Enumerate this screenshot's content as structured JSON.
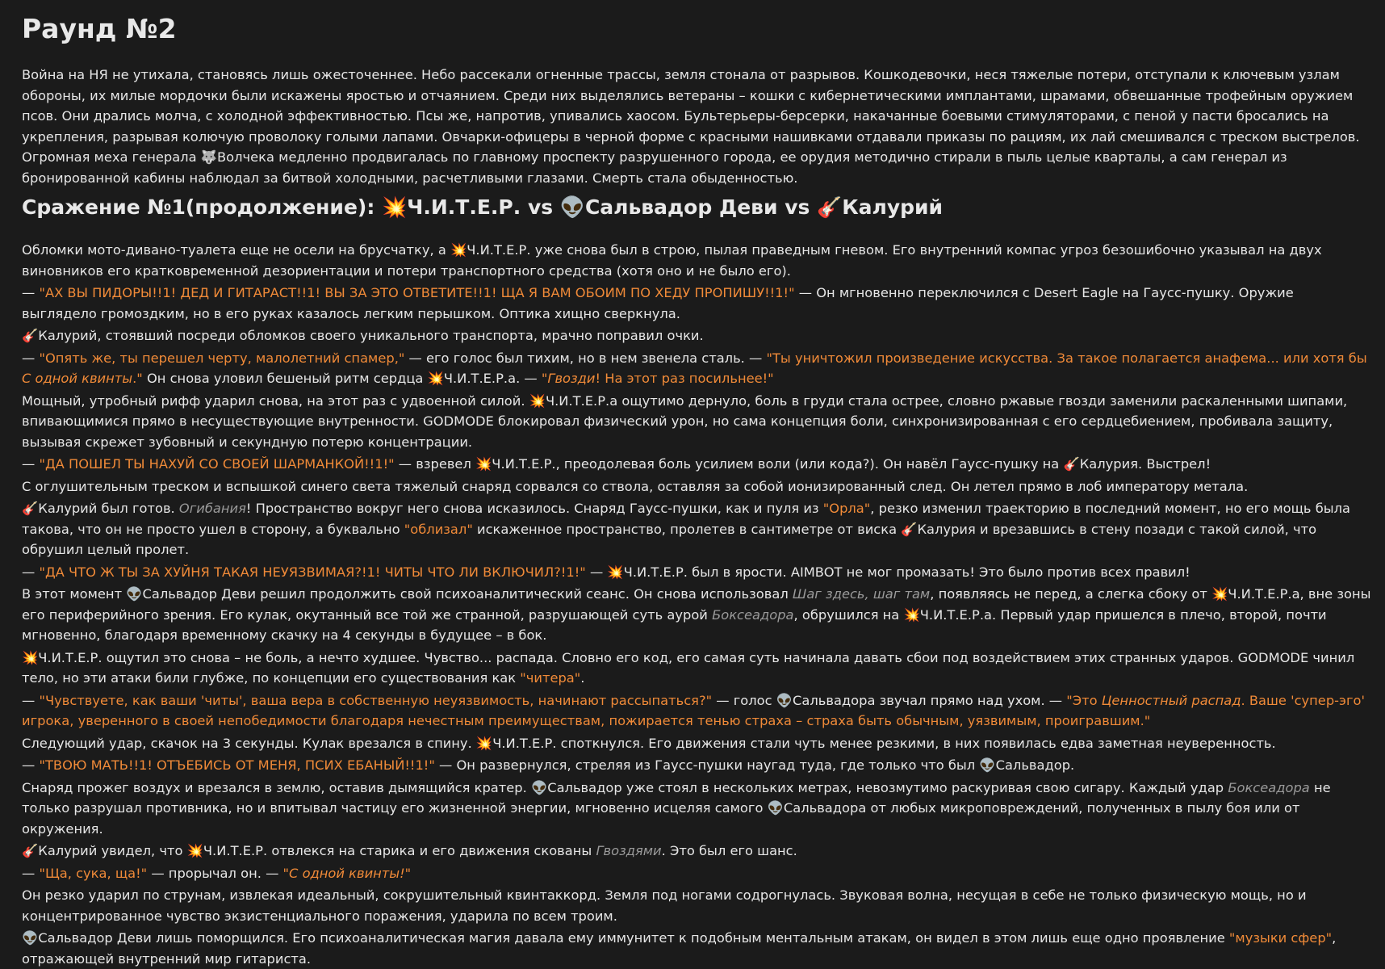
{
  "title": "Раунд №2",
  "intro": "Война на НЯ не утихала, становясь лишь ожесточеннее. Небо рассекали огненные трассы, земля стонала от разрывов. Кошкодевочки, неся тяжелые потери, отступали к ключевым узлам обороны, их милые мордочки были искажены яростью и отчаянием. Среди них выделялись ветераны – кошки с кибернетическими имплантами, шрамами, обвешанные трофейным оружием псов. Они дрались молча, с холодной эффективностью. Псы же, напротив, упивались хаосом. Бультерьеры-берсерки, накачанные боевыми стимуляторами, с пеной у пасти бросались на укрепления, разрывая колючую проволоку голыми лапами. Овчарки-офицеры в черной форме с красными нашивками отдавали приказы по рациям, их лай смешивался с треском выстрелов. Огромная меха генерала 🐺Волчека медленно продвигалась по главному проспекту разрушенного города, ее орудия методично стирали в пыль целые кварталы, а сам генерал из бронированной кабины наблюдал за битвой холодными, расчетливыми глазами. Смерть стала обыденностью.",
  "battle": {
    "prefix": "Сражение №1(продолжение): ",
    "fighter1": "💥Ч.И.Т.Е.Р.",
    "vs": " vs ",
    "fighter2": "👽Сальвадор Деви",
    "fighter3": "🎸Калурий"
  },
  "p": {
    "p1": "Обломки мото-дивано-туалета еще не осели на брусчатку, а 💥Ч.И.Т.Е.Р. уже снова был в строю, пылая праведным гневом. Его внутренний компас угроз безошибочно указывал на двух виновников его кратковременной дезориентации и потери транспортного средства (хотя оно и не было его).",
    "p2a": "— ",
    "p2q": "\"АХ ВЫ ПИДОРЫ!!1! ДЕД И ГИТАРАСТ!!1! ВЫ ЗА ЭТО ОТВЕТИТЕ!!1! ЩА Я ВАМ ОБОИМ ПО ХЕДУ ПРОПИШУ!!1!\"",
    "p2b": " — Он мгновенно переключился с Desert Eagle на Гаусс-пушку. Оружие выглядело громоздким, но в его руках казалось легким перышком. Оптика хищно сверкнула.",
    "p3": "🎸Калурий, стоявший посреди обломков своего уникального транспорта, мрачно поправил очки.",
    "p4a": "— ",
    "p4q1": "\"Опять же, ты перешел черту, малолетний спамер,\"",
    "p4b": " — его голос был тихим, но в нем звенела сталь. — ",
    "p4q2": "\"Ты уничтожил произведение искусства. За такое полагается анафема... или хотя бы ",
    "p4q2i": "С одной квинты",
    "p4q2e": ".\"",
    "p4c": " Он снова уловил бешеный ритм сердца 💥Ч.И.Т.Е.Р.а. — ",
    "p4q3i": "\"Гвозди",
    "p4q3": "! На этот раз посильнее!\"",
    "p5": "Мощный, утробный рифф ударил снова, на этот раз с удвоенной силой. 💥Ч.И.Т.Е.Р.а ощутимо дернуло, боль в груди стала острее, словно ржавые гвозди заменили раскаленными шипами, впивающимися прямо в несуществующие внутренности. GODMODE блокировал физический урон, но сама концепция боли, синхронизированная с его сердцебиением, пробивала защиту, вызывая скрежет зубовный и секундную потерю концентрации.",
    "p6a": "— ",
    "p6q": "\"ДА ПОШЕЛ ТЫ НАХУЙ СО СВОЕЙ ШАРМАНКОЙ!!1!\"",
    "p6b": " — взревел 💥Ч.И.Т.Е.Р., преодолевая боль усилием воли (или кода?). Он навёл Гаусс-пушку на 🎸Калурия. Выстрел!",
    "p7": "С оглушительным треском и вспышкой синего света тяжелый снаряд сорвался со ствола, оставляя за собой ионизированный след. Он летел прямо в лоб императору метала.",
    "p8a": "🎸Калурий был готов. ",
    "p8i": "Огибания",
    "p8b": "! Пространство вокруг него снова исказилось. Снаряд Гаусс-пушки, как и пуля из ",
    "p8q1": "\"Орла\"",
    "p8c": ", резко изменил траекторию в последний момент, но его мощь была такова, что он не просто ушел в сторону, а буквально ",
    "p8q2": "\"облизал\"",
    "p8d": " искаженное пространство, пролетев в сантиметре от виска 🎸Калурия и врезавшись в стену позади с такой силой, что обрушил целый пролет.",
    "p9a": "— ",
    "p9q": "\"ДА ЧТО Ж ТЫ ЗА ХУЙНЯ ТАКАЯ НЕУЯЗВИМАЯ?!1! ЧИТЫ ЧТО ЛИ ВКЛЮЧИЛ?!1!\"",
    "p9b": " — 💥Ч.И.Т.Е.Р. был в ярости. AIMBOT не мог промазать! Это было против всех правил!",
    "p10a": "В этот момент 👽Сальвадор Деви решил продолжить свой психоаналитический сеанс. Он снова использовал ",
    "p10i1": "Шаг здесь, шаг там",
    "p10b": ", появляясь не перед, а слегка сбоку от 💥Ч.И.Т.Е.Р.а, вне зоны его периферийного зрения. Его кулак, окутанный все той же странной, разрушающей суть аурой ",
    "p10i2": "Боксеадора",
    "p10c": ", обрушился на 💥Ч.И.Т.Е.Р.а. Первый удар пришелся в плечо, второй, почти мгновенно, благодаря временному скачку на 4 секунды в будущее – в бок.",
    "p11a": "💥Ч.И.Т.Е.Р. ощутил это снова – не боль, а нечто худшее. Чувство... распада. Словно его код, его самая суть начинала давать сбои под воздействием этих странных ударов. GODMODE чинил тело, но эти атаки били глубже, по концепции его существования как ",
    "p11q": "\"читера\"",
    "p11b": ".",
    "p12a": "— ",
    "p12q1": "\"Чувствуете, как ваши 'читы', ваша вера в собственную неуязвимость, начинают рассыпаться?\"",
    "p12b": " — голос 👽Сальвадора звучал прямо над ухом. — ",
    "p12q2a": "\"Это ",
    "p12q2i": "Ценностный распад",
    "p12q2b": ". Ваше 'супер-эго' игрока, уверенного в своей непобедимости благодаря нечестным преимуществам, пожирается тенью страха – страха быть обычным, уязвимым, проигравшим.\"",
    "p13": "Следующий удар, скачок на 3 секунды. Кулак врезался в спину. 💥Ч.И.Т.Е.Р. споткнулся. Его движения стали чуть менее резкими, в них появилась едва заметная неуверенность.",
    "p14a": "— ",
    "p14q": "\"ТВОЮ МАТЬ!!1! ОТЪЕБИСЬ ОТ МЕНЯ, ПСИХ ЕБАНЫЙ!!1!\"",
    "p14b": " — Он развернулся, стреляя из Гаусс-пушки наугад туда, где только что был 👽Сальвадор.",
    "p15a": "Снаряд прожег воздух и врезался в землю, оставив дымящийся кратер. 👽Сальвадор уже стоял в нескольких метрах, невозмутимо раскуривая свою сигару. Каждый удар ",
    "p15i": "Боксеадора",
    "p15b": " не только разрушал противника, но и впитывал частицу его жизненной энергии, мгновенно исцеляя самого 👽Сальвадора от любых микроповреждений, полученных в пылу боя или от окружения.",
    "p16a": "🎸Калурий увидел, что 💥Ч.И.Т.Е.Р. отвлекся на старика и его движения скованы ",
    "p16i": "Гвоздями",
    "p16b": ". Это был его шанс.",
    "p17a": "— ",
    "p17q1": "\"Ща, сука, ща!\"",
    "p17b": " — прорычал он. — ",
    "p17q2": "\"С одной квинты!\"",
    "p18": "Он резко ударил по струнам, извлекая идеальный, сокрушительный квинтаккорд. Земля под ногами содрогнулась. Звуковая волна, несущая в себе не только физическую мощь, но и концентрированное чувство экзистенциального поражения, ударила по всем троим.",
    "p19a": "👽Сальвадор Деви лишь поморщился. Его психоаналитическая магия давала ему иммунитет к подобным ментальным атакам, он видел в этом лишь еще одно проявление ",
    "p19q": "\"музыки сфер\"",
    "p19b": ", отражающей внутренний мир гитариста."
  },
  "colors": {
    "background": "#1b1b1b",
    "text": "#e6e6e6",
    "quote": "#f08a38",
    "italic": "#9a9a9a"
  }
}
